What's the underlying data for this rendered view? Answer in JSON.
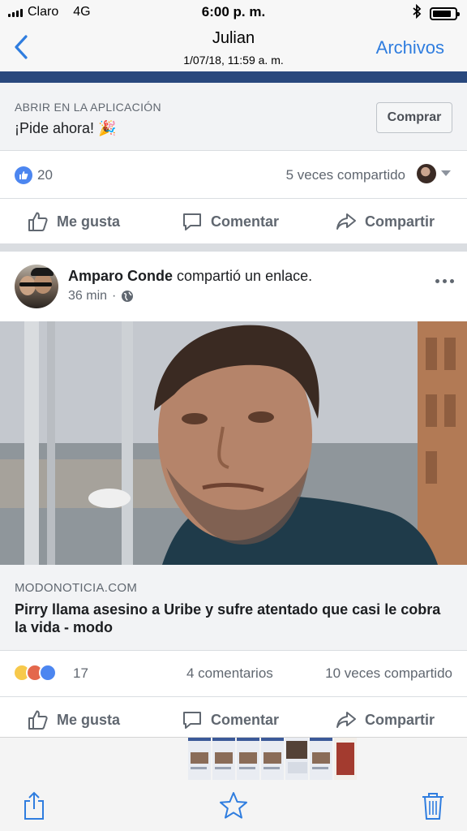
{
  "status_bar": {
    "carrier": "Claro",
    "network": "4G",
    "time": "6:00 p. m.",
    "battery_level": 0.85
  },
  "nav": {
    "back_icon": "chevron-left-icon",
    "title": "Julian",
    "subtitle": "1/07/18, 11:59 a. m.",
    "right_label": "Archivos",
    "accent_color": "#2f7ddf"
  },
  "cta": {
    "label": "ABRIR EN LA APLICACIÓN",
    "title": "¡Pide ahora! 🎉",
    "button": "Comprar"
  },
  "post1": {
    "like_count": "20",
    "shares": "5 veces compartido"
  },
  "actions": {
    "like": "Me gusta",
    "comment": "Comentar",
    "share": "Compartir"
  },
  "post2": {
    "author": "Amparo Conde",
    "action_text": " compartió un enlace.",
    "time": "36 min",
    "visibility_icon": "globe-icon",
    "link_domain": "MODONOTICIA.COM",
    "link_title": "Pirry llama asesino a Uribe y sufre atentado que casi le cobra la vida - modo",
    "reaction_count": "17",
    "comments": "4 comentarios",
    "shares": "10 veces compartido"
  },
  "toolbar": {
    "share_icon": "share-icon",
    "favorite_icon": "star-icon",
    "delete_icon": "trash-icon"
  },
  "colors": {
    "facebook_navy": "#29487d",
    "like_blue": "#4c86f0",
    "ios_blue": "#2f7ddf"
  }
}
